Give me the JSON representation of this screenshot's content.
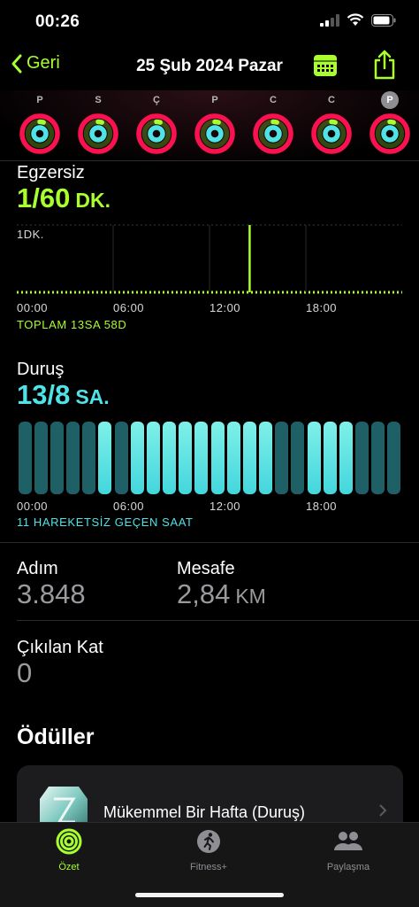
{
  "status": {
    "time": "00:26"
  },
  "nav": {
    "back_label": "Geri",
    "title": "25 Şub 2024 Pazar"
  },
  "week": {
    "days": [
      {
        "letter": "P",
        "current": false
      },
      {
        "letter": "S",
        "current": false
      },
      {
        "letter": "Ç",
        "current": false
      },
      {
        "letter": "P",
        "current": false
      },
      {
        "letter": "C",
        "current": false
      },
      {
        "letter": "C",
        "current": false
      },
      {
        "letter": "P",
        "current": true
      }
    ]
  },
  "exercise": {
    "label": "Egzersiz",
    "value": "1/60",
    "unit": "DK.",
    "max_label": "1DK.",
    "x_ticks": [
      "00:00",
      "06:00",
      "12:00",
      "18:00"
    ],
    "caption": "TOPLAM 13SA 58D",
    "spike_hour": 14.5
  },
  "stand": {
    "label": "Duruş",
    "value": "13/8",
    "unit": "SA.",
    "x_ticks": [
      "00:00",
      "06:00",
      "12:00",
      "18:00"
    ],
    "caption": "11 HAREKETSİZ GEÇEN SAAT",
    "hours_stood": [
      0,
      0,
      0,
      0,
      0,
      1,
      0,
      1,
      1,
      1,
      1,
      1,
      1,
      1,
      1,
      1,
      0,
      0,
      1,
      1,
      1,
      0,
      0,
      0
    ]
  },
  "steps": {
    "label": "Adım",
    "value": "3.848"
  },
  "distance": {
    "label": "Mesafe",
    "value": "2,84",
    "unit": "KM"
  },
  "floors": {
    "label": "Çıkılan Kat",
    "value": "0"
  },
  "awards": {
    "title": "Ödüller",
    "items": [
      {
        "name": "Mükemmel Bir Hafta (Duruş)"
      }
    ]
  },
  "tabs": [
    {
      "label": "Özet",
      "active": true
    },
    {
      "label": "Fitness+",
      "active": false
    },
    {
      "label": "Paylaşma",
      "active": false
    }
  ],
  "colors": {
    "exercise": "#a8ff2d",
    "stand": "#4fe3e7",
    "move": "#fa114f",
    "accent": "#a8ff2d"
  }
}
